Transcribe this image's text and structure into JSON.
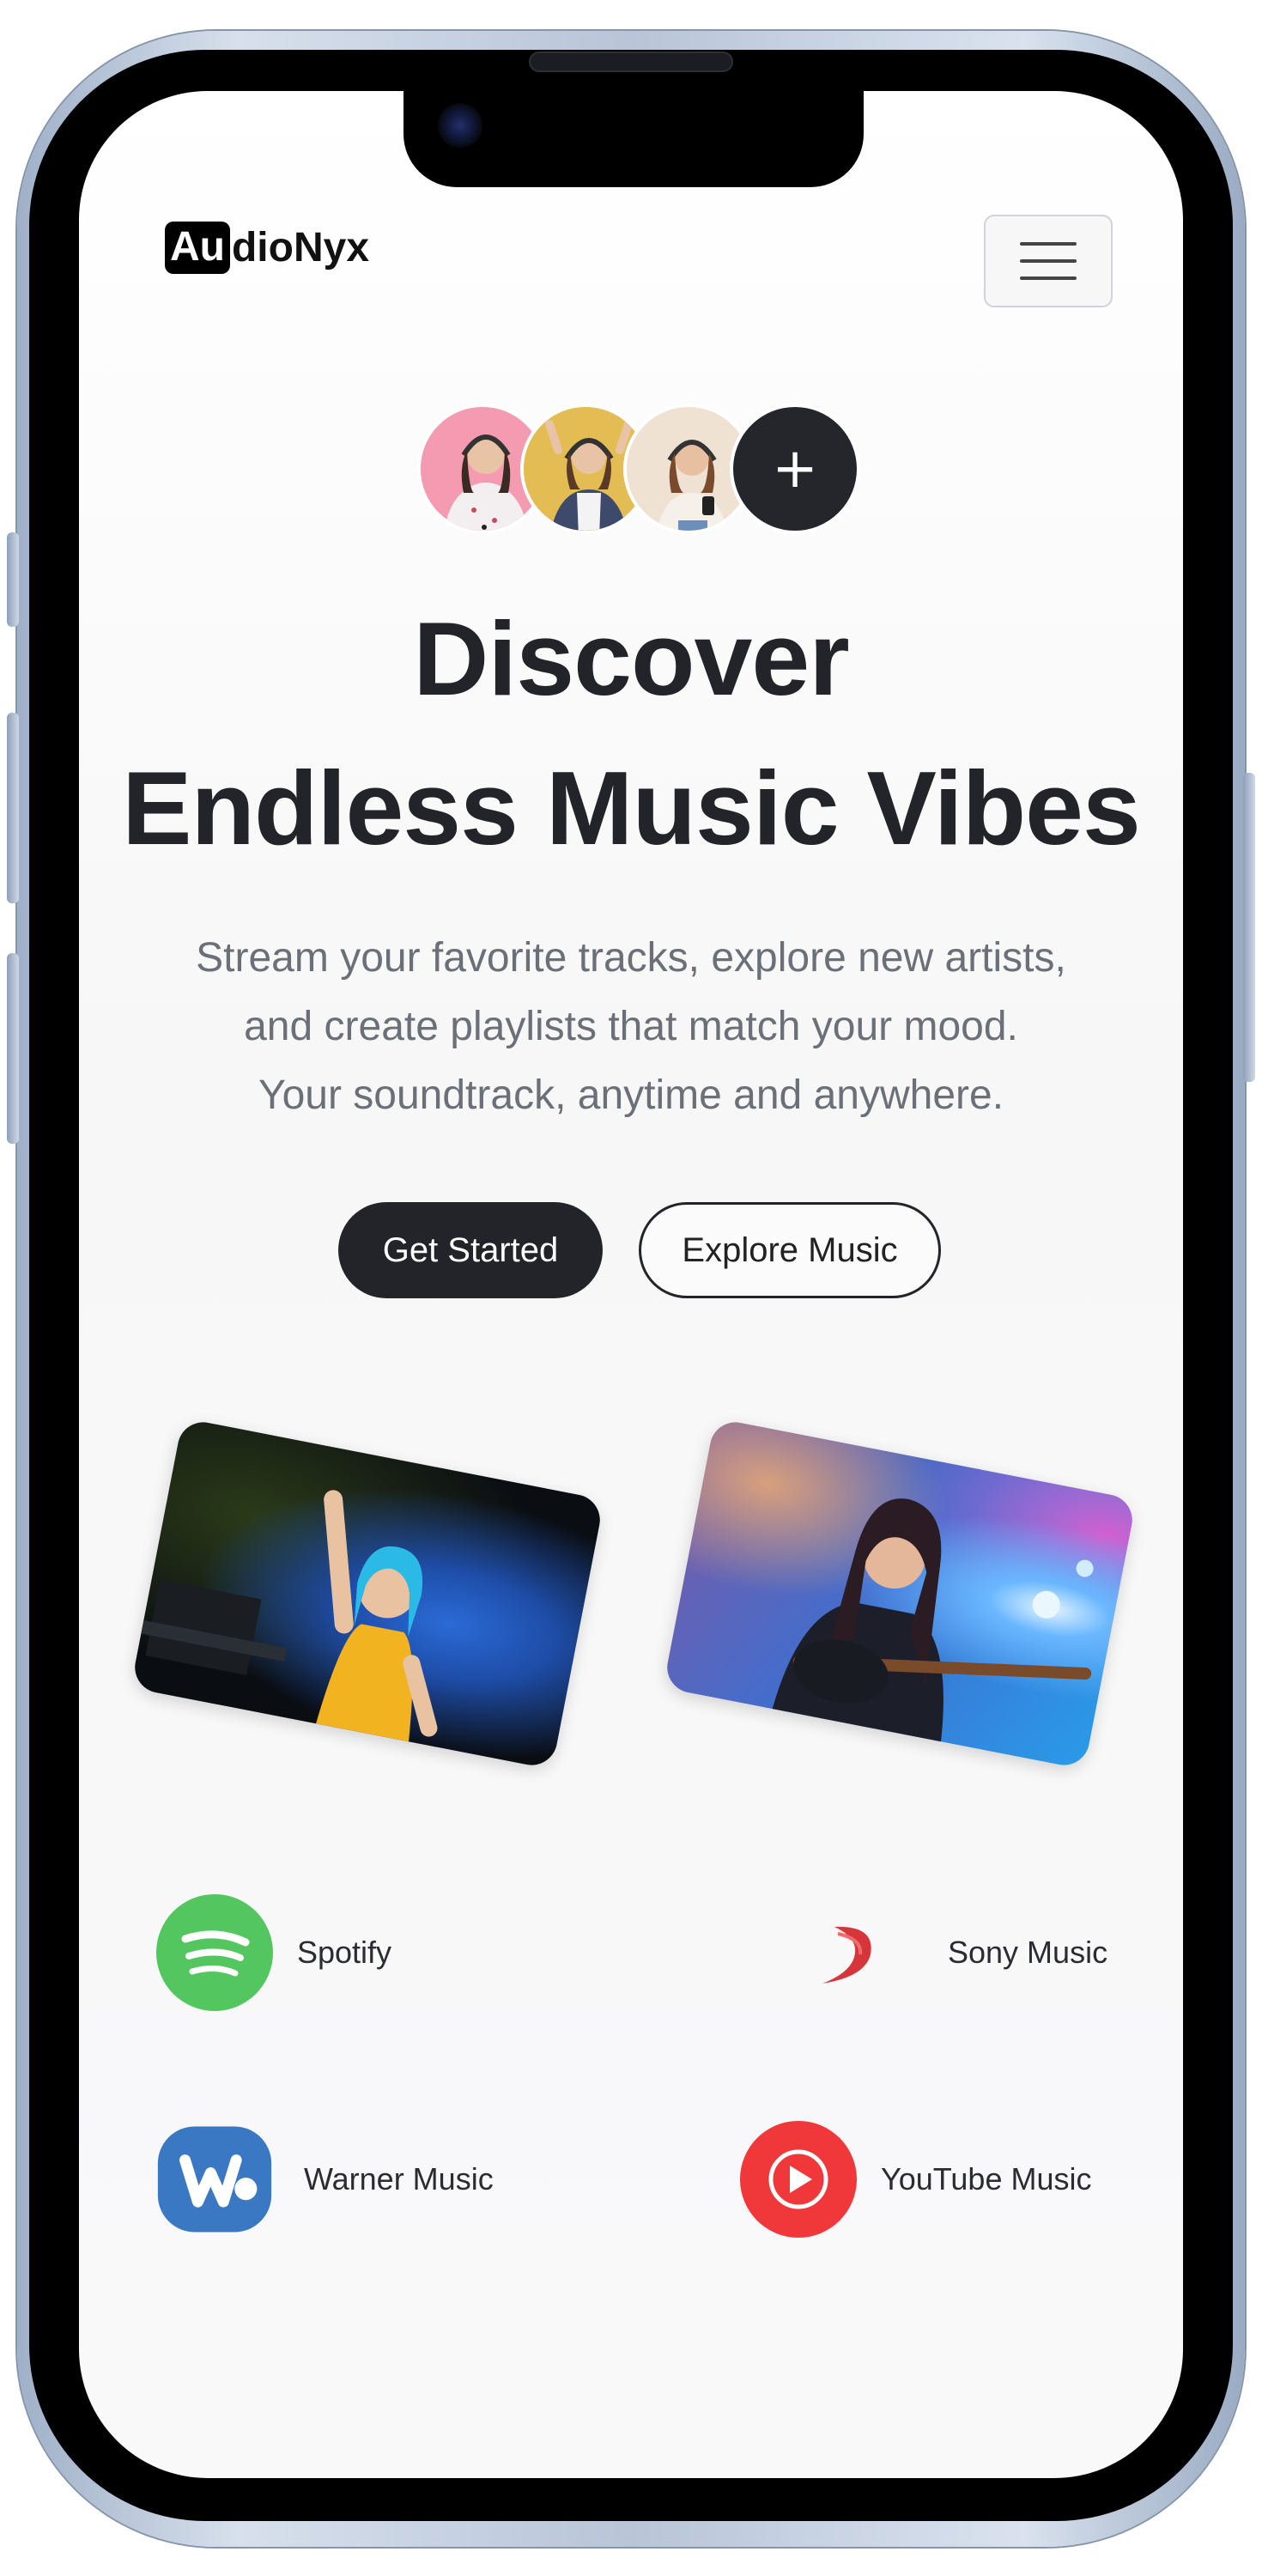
{
  "brand": {
    "logo_box": "Au",
    "logo_rest": "dioNyx"
  },
  "header": {
    "menu_icon": "hamburger-menu-icon"
  },
  "avatars": {
    "plus_label": "+",
    "items": [
      "listener-avatar-pink",
      "listener-avatar-yellow",
      "listener-avatar-beige"
    ]
  },
  "hero": {
    "title_line1": "Discover",
    "title_line2": "Endless Music Vibes",
    "subtitle_line1": "Stream your favorite tracks, explore new artists,",
    "subtitle_line2": "and create playlists that match your mood.",
    "subtitle_line3": "Your soundtrack, anytime and anywhere."
  },
  "buttons": {
    "primary": "Get Started",
    "secondary": "Explore Music"
  },
  "photos": [
    "dj-performer-photo",
    "guitarist-photo"
  ],
  "partners": [
    {
      "name": "Spotify",
      "icon": "spotify-icon",
      "color": "#53c65f"
    },
    {
      "name": "Sony Music",
      "icon": "sony-music-icon",
      "color": "#d6363a"
    },
    {
      "name": "Warner Music",
      "icon": "warner-music-icon",
      "color": "#3b78c3"
    },
    {
      "name": "YouTube Music",
      "icon": "youtube-music-icon",
      "color": "#f0373a"
    }
  ],
  "colors": {
    "dark": "#222429",
    "muted_text": "#6b6f77"
  }
}
